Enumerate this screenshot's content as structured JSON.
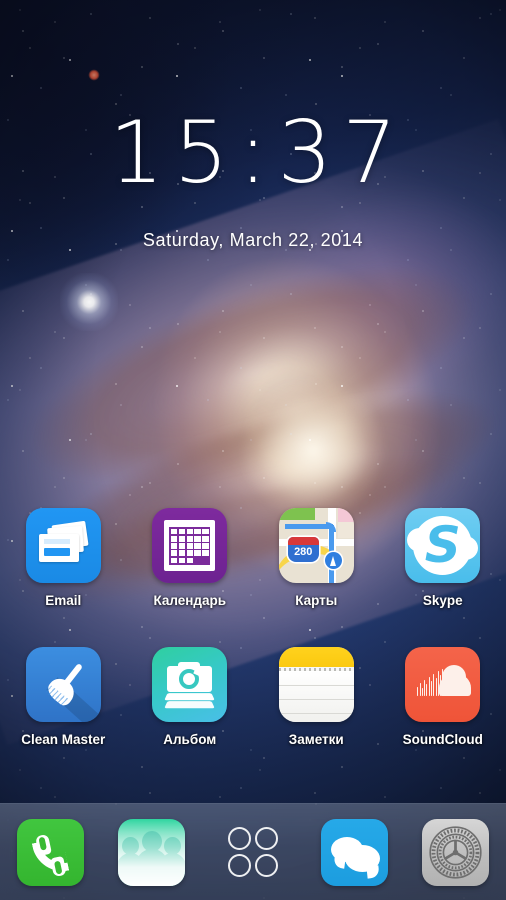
{
  "clock": {
    "time": "15:37",
    "date": "Saturday,  March 22,  2014"
  },
  "home_rows": [
    [
      {
        "label": "Email",
        "icon": "email-icon"
      },
      {
        "label": "Календарь",
        "icon": "calendar-icon"
      },
      {
        "label": "Карты",
        "icon": "maps-icon"
      },
      {
        "label": "Skype",
        "icon": "skype-icon"
      }
    ],
    [
      {
        "label": "Clean Master",
        "icon": "clean-master-icon"
      },
      {
        "label": "Альбом",
        "icon": "album-icon"
      },
      {
        "label": "Заметки",
        "icon": "notes-icon"
      },
      {
        "label": "SoundCloud",
        "icon": "soundcloud-icon"
      }
    ]
  ],
  "maps_icon": {
    "shield_number": "280"
  },
  "skype_icon": {
    "letter": "S"
  },
  "dock": [
    {
      "name": "phone",
      "icon": "phone-icon"
    },
    {
      "name": "contacts",
      "icon": "contacts-icon"
    },
    {
      "name": "app-drawer",
      "icon": "app-drawer-icon"
    },
    {
      "name": "messages",
      "icon": "messages-icon"
    },
    {
      "name": "settings",
      "icon": "settings-gear-icon"
    }
  ],
  "colors": {
    "email": "#2196f3",
    "calendar": "#7b2b9b",
    "maps_bg": "#e9e2d3",
    "maps_shield_red": "#d8383a",
    "maps_shield_blue": "#2f6fd0",
    "skype": "#49bdeb",
    "clean_master": "#3c8ee0",
    "album": "#36c9c6",
    "notes_yellow": "#fbc90f",
    "soundcloud": "#ef5438",
    "phone_green": "#34b52f",
    "contacts_green": "#2fbfa0",
    "messages_blue": "#1c9ddf",
    "settings_gray": "#bdbdbd",
    "label_text": "#ffffff",
    "dock_tint": "#6e7a94"
  },
  "wallpaper": {
    "name": "andromeda-galaxy"
  }
}
